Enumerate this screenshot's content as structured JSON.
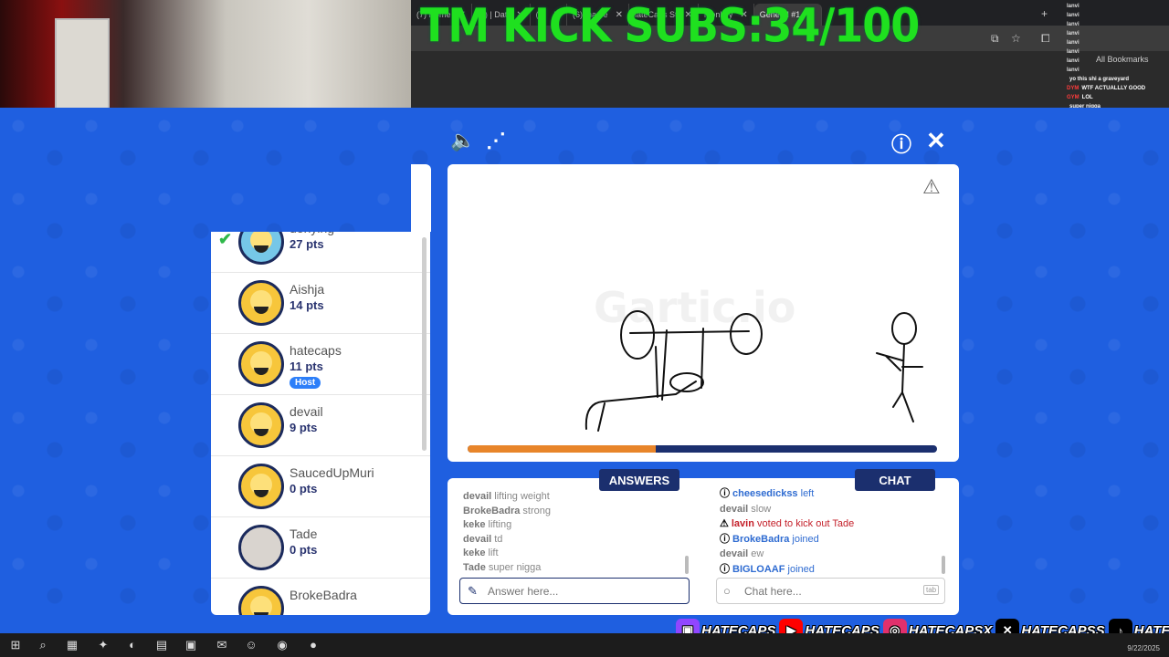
{
  "overlay": {
    "sub_banner": "TM KICK SUBS:34/100"
  },
  "browser": {
    "tabs": [
      {
        "label": "(7) Home",
        "active": false
      },
      {
        "label": "(7) | Dati",
        "active": false
      },
      {
        "label": "(2)",
        "active": false
      },
      {
        "label": "(6) tha be",
        "active": false
      },
      {
        "label": "iateCaps St",
        "active": false
      },
      {
        "label": "Monkey",
        "active": false
      },
      {
        "label": "General #1",
        "active": true
      }
    ],
    "bookmarks_label": "All Bookmarks"
  },
  "stream_chat": [
    {
      "user": "lanvi",
      "msg": ""
    },
    {
      "user": "lanvi",
      "msg": ""
    },
    {
      "user": "lanvi",
      "msg": ""
    },
    {
      "user": "lanvi",
      "msg": ""
    },
    {
      "user": "lanvi",
      "msg": ""
    },
    {
      "user": "lanvi",
      "msg": ""
    },
    {
      "user": "lanvi",
      "msg": ""
    },
    {
      "user": "lanvi",
      "msg": ""
    },
    {
      "user": "",
      "msg": "yo this shi a graveyard"
    },
    {
      "user": "DYM",
      "msg": "WTF ACTUALLLY GOOD"
    },
    {
      "user": "GYM",
      "msg": "LOL"
    },
    {
      "user": "",
      "msg": "super nigga"
    }
  ],
  "players": [
    {
      "name": "denying",
      "pts": "27 pts",
      "guessed": true,
      "avatar": "blue"
    },
    {
      "name": "Aishja",
      "pts": "14 pts",
      "guessed": false,
      "avatar": "default"
    },
    {
      "name": "hatecaps",
      "pts": "11 pts",
      "guessed": false,
      "avatar": "default",
      "badge": "Host"
    },
    {
      "name": "devail",
      "pts": "9 pts",
      "guessed": false,
      "avatar": "default"
    },
    {
      "name": "SaucedUpMuri",
      "pts": "0 pts",
      "guessed": false,
      "avatar": "default"
    },
    {
      "name": "Tade",
      "pts": "0 pts",
      "guessed": false,
      "avatar": "photo"
    },
    {
      "name": "BrokeBadra",
      "pts": "",
      "guessed": false,
      "avatar": "default"
    }
  ],
  "canvas": {
    "watermark": "Gartic.io",
    "timer_fraction": 0.4
  },
  "answers": {
    "tab_label": "ANSWERS",
    "messages": [
      {
        "user": "devail",
        "text": "lifting weight"
      },
      {
        "user": "BrokeBadra",
        "text": "strong"
      },
      {
        "user": "keke",
        "text": "lifting"
      },
      {
        "user": "devail",
        "text": "td"
      },
      {
        "user": "keke",
        "text": "lift"
      },
      {
        "user": "Tade",
        "text": "super nigga"
      }
    ],
    "placeholder": "Answer here..."
  },
  "chat": {
    "tab_label": "CHAT",
    "messages": [
      {
        "type": "sys",
        "icon": "ⓘ",
        "user": "cheesedickss",
        "text": "left"
      },
      {
        "type": "normal",
        "icon": "",
        "user": "devail",
        "text": "slow"
      },
      {
        "type": "kick",
        "icon": "⚠",
        "user": "lavin",
        "text": "voted to kick out Tade"
      },
      {
        "type": "sys",
        "icon": "ⓘ",
        "user": "BrokeBadra",
        "text": "joined"
      },
      {
        "type": "normal",
        "icon": "",
        "user": "devail",
        "text": "ew"
      },
      {
        "type": "sys",
        "icon": "ⓘ",
        "user": "BIGLOAAF",
        "text": "joined"
      }
    ],
    "placeholder": "Chat here...",
    "tab_hint": "tab"
  },
  "socials": [
    {
      "icon": "twitch-icon",
      "glyph": "▣",
      "color": "#9146ff",
      "label": "HATECAPS"
    },
    {
      "icon": "youtube-icon",
      "glyph": "▶",
      "color": "#ff0000",
      "label": "HATECAPS"
    },
    {
      "icon": "instagram-icon",
      "glyph": "◎",
      "color": "#e1306c",
      "label": "HATECAPSX"
    },
    {
      "icon": "x-icon",
      "glyph": "✕",
      "color": "#000000",
      "label": "HATECAPSS"
    },
    {
      "icon": "tiktok-icon",
      "glyph": "♪",
      "color": "#000000",
      "label": "HATECAPS_"
    }
  ],
  "taskbar": {
    "date": "9/22/2025"
  }
}
